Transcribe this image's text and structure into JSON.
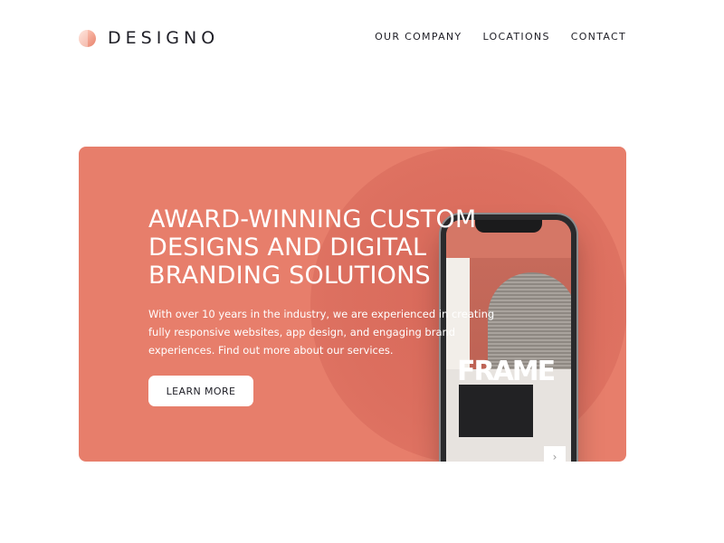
{
  "header": {
    "logo_text": "DESIGNO",
    "nav": [
      {
        "label": "OUR COMPANY"
      },
      {
        "label": "LOCATIONS"
      },
      {
        "label": "CONTACT"
      }
    ]
  },
  "hero": {
    "title_lines": [
      "AWARD-WINNING CUSTOM",
      "DESIGNS AND DIGITAL",
      "BRANDING SOLUTIONS"
    ],
    "description": "With over 10 years in the industry, we are experienced in creating fully responsive websites, app design, and engaging brand experiences. Find out more about our services.",
    "cta_label": "LEARN MORE",
    "phone_screen": {
      "brand_word": "FRAME",
      "next_arrow": "›"
    }
  },
  "colors": {
    "accent": "#e77e6b",
    "text_dark": "#1e1e26",
    "white": "#ffffff"
  },
  "icons": {
    "logo": "designo-logo-icon",
    "next": "chevron-right-icon"
  }
}
